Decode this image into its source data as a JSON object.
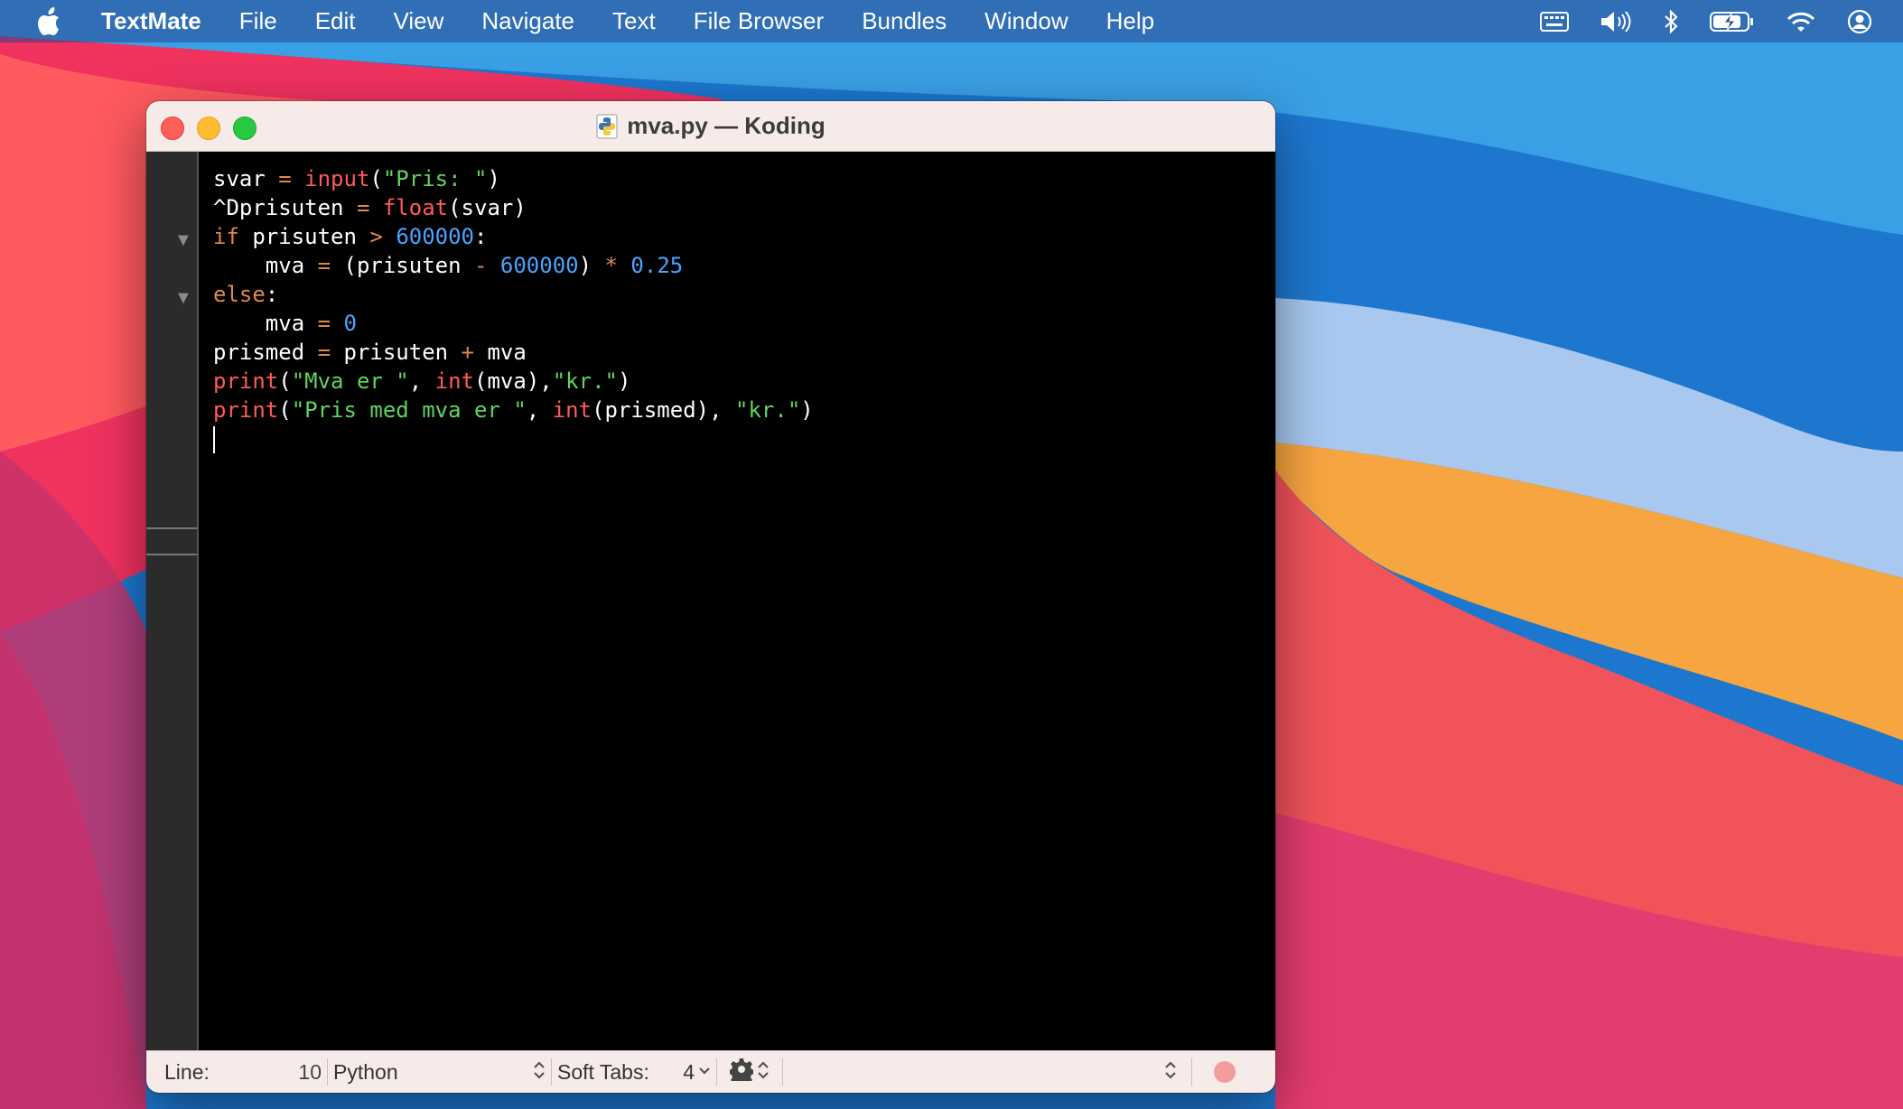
{
  "menubar": {
    "app_name": "TextMate",
    "items": [
      "File",
      "Edit",
      "View",
      "Navigate",
      "Text",
      "File Browser",
      "Bundles",
      "Window",
      "Help"
    ],
    "status_icons": [
      "keyboard-icon",
      "volume-icon",
      "bluetooth-icon",
      "battery-icon",
      "wifi-icon",
      "user-icon"
    ]
  },
  "window": {
    "title": "mva.py — Koding",
    "file_icon": "python-file-icon"
  },
  "editor": {
    "lines": [
      [
        {
          "t": "svar "
        },
        {
          "t": "=",
          "c": "op"
        },
        {
          "t": " "
        },
        {
          "t": "input",
          "c": "fn"
        },
        {
          "t": "("
        },
        {
          "t": "\"Pris: \"",
          "c": "str"
        },
        {
          "t": ")"
        }
      ],
      [
        {
          "t": "^Dprisuten "
        },
        {
          "t": "=",
          "c": "op"
        },
        {
          "t": " "
        },
        {
          "t": "float",
          "c": "fn"
        },
        {
          "t": "(svar)"
        }
      ],
      [
        {
          "t": "if",
          "c": "kw"
        },
        {
          "t": " prisuten "
        },
        {
          "t": ">",
          "c": "op"
        },
        {
          "t": " "
        },
        {
          "t": "600000",
          "c": "num"
        },
        {
          "t": ":"
        }
      ],
      [
        {
          "t": "    mva "
        },
        {
          "t": "=",
          "c": "op"
        },
        {
          "t": " (prisuten "
        },
        {
          "t": "-",
          "c": "op"
        },
        {
          "t": " "
        },
        {
          "t": "600000",
          "c": "num"
        },
        {
          "t": ") "
        },
        {
          "t": "*",
          "c": "op"
        },
        {
          "t": " "
        },
        {
          "t": "0.25",
          "c": "num"
        }
      ],
      [
        {
          "t": "else",
          "c": "kw"
        },
        {
          "t": ":"
        }
      ],
      [
        {
          "t": "    mva "
        },
        {
          "t": "=",
          "c": "op"
        },
        {
          "t": " "
        },
        {
          "t": "0",
          "c": "num"
        }
      ],
      [
        {
          "t": "prismed "
        },
        {
          "t": "=",
          "c": "op"
        },
        {
          "t": " prisuten "
        },
        {
          "t": "+",
          "c": "op"
        },
        {
          "t": " mva"
        }
      ],
      [
        {
          "t": "print",
          "c": "fn"
        },
        {
          "t": "("
        },
        {
          "t": "\"Mva er \"",
          "c": "str"
        },
        {
          "t": ", "
        },
        {
          "t": "int",
          "c": "fn"
        },
        {
          "t": "(mva),"
        },
        {
          "t": "\"kr.\"",
          "c": "str"
        },
        {
          "t": ")"
        }
      ],
      [
        {
          "t": "print",
          "c": "fn"
        },
        {
          "t": "("
        },
        {
          "t": "\"Pris med mva er \"",
          "c": "str"
        },
        {
          "t": ", "
        },
        {
          "t": "int",
          "c": "fn"
        },
        {
          "t": "(prismed), "
        },
        {
          "t": "\"kr.\"",
          "c": "str"
        },
        {
          "t": ")"
        }
      ]
    ],
    "fold_markers": [
      "▼",
      "▼"
    ]
  },
  "statusbar": {
    "line_label": "Line:",
    "line_number": "10",
    "language": "Python",
    "soft_tabs_label": "Soft Tabs:",
    "tab_size": "4"
  },
  "colors": {
    "keyword": "#e0884b",
    "function": "#ff5a5a",
    "string": "#5fd45f",
    "number": "#4aa3ff"
  }
}
